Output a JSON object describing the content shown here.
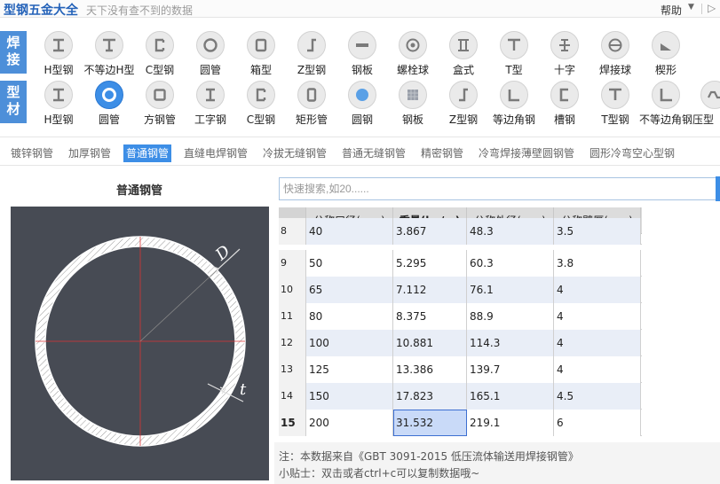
{
  "app": {
    "title": "型钢五金大全",
    "slogan": "天下没有查不到的数据",
    "help_menu": "帮助",
    "caret": "▼",
    "collapse": "▷"
  },
  "categories": {
    "weld": {
      "chars": [
        "焊",
        "接"
      ]
    },
    "profile": {
      "chars": [
        "型",
        "材"
      ]
    }
  },
  "toolbar": {
    "row1": [
      {
        "label": "H型钢",
        "icon": "h-beam-icon"
      },
      {
        "label": "不等边H型",
        "icon": "t-beam-icon"
      },
      {
        "label": "C型钢",
        "icon": "c-channel-icon"
      },
      {
        "label": "圆管",
        "icon": "round-tube-icon"
      },
      {
        "label": "箱型",
        "icon": "box-section-icon"
      },
      {
        "label": "Z型钢",
        "icon": "z-section-icon"
      },
      {
        "label": "钢板",
        "icon": "steel-plate-icon"
      },
      {
        "label": "螺栓球",
        "icon": "bolt-ball-icon"
      },
      {
        "label": "盒式",
        "icon": "box-type-icon"
      },
      {
        "label": "T型",
        "icon": "t-section-icon"
      },
      {
        "label": "十字",
        "icon": "cross-section-icon"
      },
      {
        "label": "焊接球",
        "icon": "weld-ball-icon"
      },
      {
        "label": "楔形",
        "icon": "wedge-icon"
      }
    ],
    "row2": [
      {
        "label": "H型钢",
        "icon": "h-beam-icon"
      },
      {
        "label": "圆管",
        "icon": "round-tube-icon",
        "active": true
      },
      {
        "label": "方钢管",
        "icon": "square-tube-icon"
      },
      {
        "label": "工字钢",
        "icon": "i-beam-icon"
      },
      {
        "label": "C型钢",
        "icon": "c-channel-icon"
      },
      {
        "label": "矩形管",
        "icon": "rect-tube-icon"
      },
      {
        "label": "圆钢",
        "icon": "round-bar-icon"
      },
      {
        "label": "钢板",
        "icon": "steel-plate-icon"
      },
      {
        "label": "Z型钢",
        "icon": "z-section-icon"
      },
      {
        "label": "等边角钢",
        "icon": "equal-angle-icon"
      },
      {
        "label": "槽钢",
        "icon": "channel-icon"
      },
      {
        "label": "T型钢",
        "icon": "t-section-icon"
      },
      {
        "label": "不等边角钢",
        "icon": "unequal-angle-icon"
      },
      {
        "label": "压型",
        "icon": "profiled-sheet-icon"
      }
    ]
  },
  "subtabs": [
    {
      "label": "镀锌钢管"
    },
    {
      "label": "加厚钢管"
    },
    {
      "label": "普通钢管",
      "active": true
    },
    {
      "label": "直缝电焊钢管"
    },
    {
      "label": "冷拔无缝钢管"
    },
    {
      "label": "普通无缝钢管"
    },
    {
      "label": "精密钢管"
    },
    {
      "label": "冷弯焊接薄壁圆钢管"
    },
    {
      "label": "圆形冷弯空心型钢"
    }
  ],
  "left_panel": {
    "title": "普通钢管",
    "diagram": {
      "label_d": "D",
      "label_t": "t"
    }
  },
  "search": {
    "placeholder": "快速搜索,如20......",
    "value": ""
  },
  "table": {
    "headers": [
      "",
      "公称口径(mm)",
      "重量(kg/m)",
      "公称外径(mm)",
      "公称壁厚(mm)"
    ],
    "rows": [
      [
        "8",
        "40",
        "3.867",
        "48.3",
        "3.5"
      ],
      [
        "9",
        "50",
        "5.295",
        "60.3",
        "3.8"
      ],
      [
        "10",
        "65",
        "7.112",
        "76.1",
        "4"
      ],
      [
        "11",
        "80",
        "8.375",
        "88.9",
        "4"
      ],
      [
        "12",
        "100",
        "10.881",
        "114.3",
        "4"
      ],
      [
        "13",
        "125",
        "13.386",
        "139.7",
        "4"
      ],
      [
        "14",
        "150",
        "17.823",
        "165.1",
        "4.5"
      ],
      [
        "15",
        "200",
        "31.532",
        "219.1",
        "6"
      ]
    ],
    "selected_row": 7,
    "selected_col": 2
  },
  "notes": {
    "source": "注：本数据来自《GBT 3091-2015 低压流体输送用焊接钢管》",
    "tip": "小贴士：双击或者ctrl+c可以复制数据哦~"
  },
  "colors": {
    "accent": "#3d8ee6",
    "category_badge": "#4d8fd9",
    "diagram_bg": "#474b54",
    "selected_cell": "#c9daf8"
  }
}
